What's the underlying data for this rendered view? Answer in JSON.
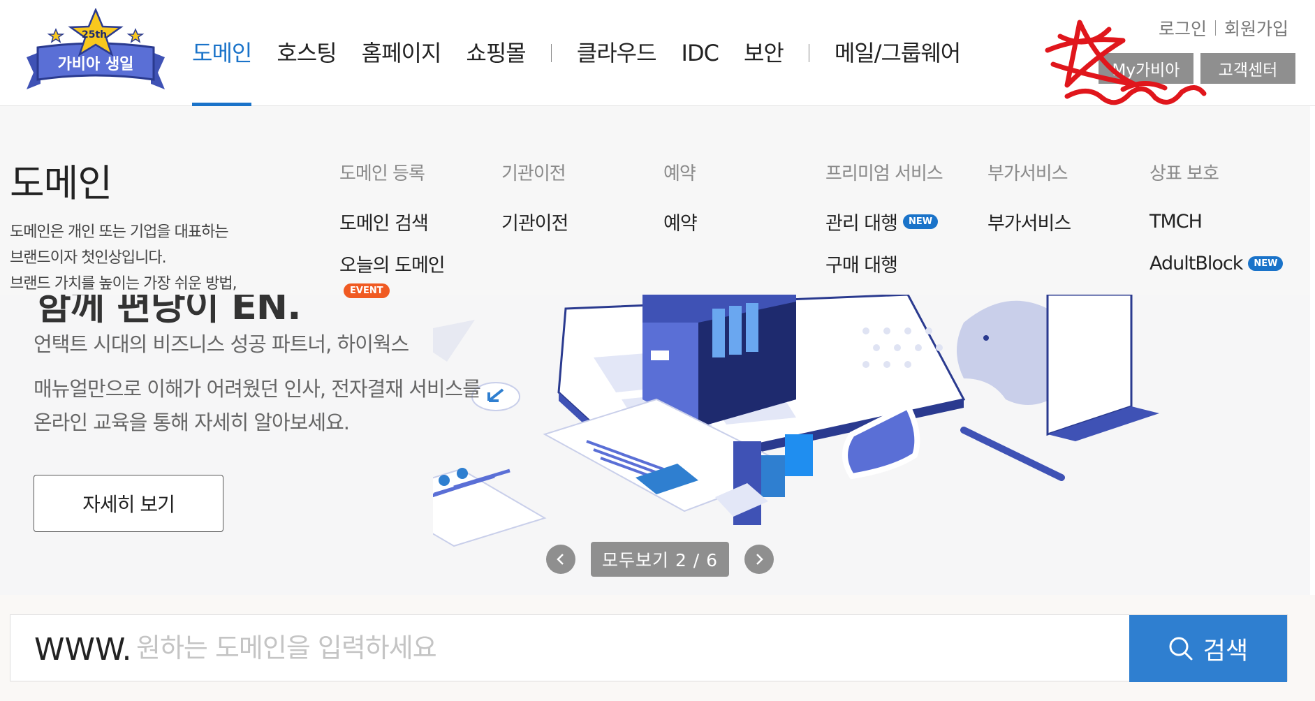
{
  "logo": {
    "badge": "25th",
    "text": "가비아 생일"
  },
  "gnb": {
    "items": [
      "도메인",
      "호스팅",
      "홈페이지",
      "쇼핑몰",
      "클라우드",
      "IDC",
      "보안",
      "메일/그룹웨어"
    ]
  },
  "util": {
    "login": "로그인",
    "join": "회원가입",
    "my": "My가비아",
    "cs": "고객센터"
  },
  "mega": {
    "title": "도메인",
    "desc": [
      "도메인은 개인 또는 기업을 대표하는",
      "브랜드이자 첫인상입니다.",
      "브랜드 가치를 높이는 가장 쉬운 방법,"
    ],
    "columns": [
      {
        "head": "도메인 등록",
        "links": [
          "도메인 검색",
          "오늘의 도메인"
        ]
      },
      {
        "head": "기관이전",
        "links": [
          "기관이전"
        ]
      },
      {
        "head": "예약",
        "links": [
          "예약"
        ]
      },
      {
        "head": "프리미엄 서비스",
        "links": [
          "관리 대행",
          "구매 대행"
        ]
      },
      {
        "head": "부가서비스",
        "links": [
          "부가서비스"
        ]
      },
      {
        "head": "상표 보호",
        "links": [
          "TMCH",
          "AdultBlock"
        ]
      }
    ],
    "new_badge": "NEW",
    "event_badge": "EVENT"
  },
  "banner": {
    "headline": "함께 편당이 EN.",
    "subtitle": "언택트 시대의 비즈니스 성공 파트너, 하이웍스",
    "desc": [
      "매뉴얼만으로 이해가 어려웠던 인사, 전자결재 서비스를",
      "온라인 교육을 통해 자세히 알아보세요."
    ],
    "button": "자세히 보기",
    "pager": "모두보기 2 / 6"
  },
  "search": {
    "prefix": "WWW.",
    "placeholder": "원하는 도메인을 입력하세요",
    "button": "검색"
  },
  "colors": {
    "accent": "#1a73c9",
    "search_button": "#2f7fd0",
    "event": "#f05a22",
    "annotation": "#e0161c"
  }
}
